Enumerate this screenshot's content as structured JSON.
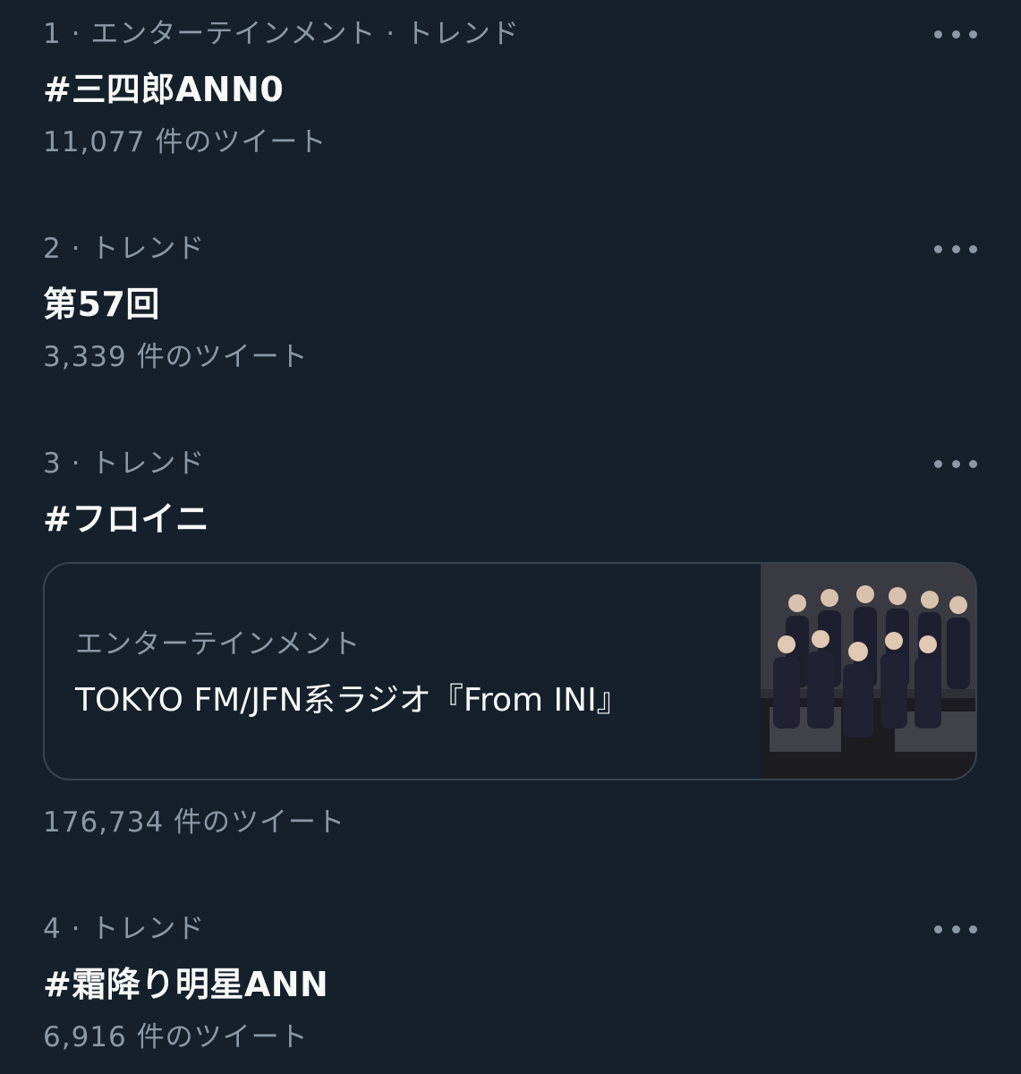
{
  "trends": [
    {
      "meta": "1 · エンターテインメント · トレンド",
      "title": "#三四郎ANN0",
      "count": "11,077 件のツイート"
    },
    {
      "meta": "2 · トレンド",
      "title": "第57回",
      "count": "3,339 件のツイート"
    },
    {
      "meta": "3 · トレンド",
      "title": "#フロイニ",
      "count": "176,734 件のツイート",
      "event": {
        "category": "エンターテインメント",
        "title": "TOKYO FM/JFN系ラジオ『From INI』"
      }
    },
    {
      "meta": "4 · トレンド",
      "title": "#霜降り明星ANN",
      "count": "6,916 件のツイート"
    }
  ],
  "colors": {
    "background": "#15202b",
    "primary_text": "#f7f9f9",
    "secondary_text": "#8b98a5",
    "border": "#38444d"
  },
  "icons": {
    "more": "more-horizontal-icon"
  }
}
